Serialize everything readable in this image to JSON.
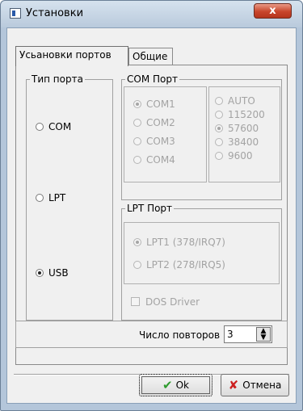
{
  "window": {
    "title": "Установки",
    "close_label": "x"
  },
  "tabs": [
    {
      "label": "Усьановки портов",
      "active": true
    },
    {
      "label": "Общие",
      "active": false
    }
  ],
  "port_type": {
    "title": "Тип порта",
    "options": [
      {
        "label": "COM",
        "checked": false
      },
      {
        "label": "LPT",
        "checked": false
      },
      {
        "label": "USB",
        "checked": true
      }
    ]
  },
  "com_port": {
    "title": "COM Порт",
    "ports": [
      {
        "label": "COM1",
        "checked": true
      },
      {
        "label": "COM2",
        "checked": false
      },
      {
        "label": "COM3",
        "checked": false
      },
      {
        "label": "COM4",
        "checked": false
      }
    ],
    "speeds": [
      {
        "label": "AUTO",
        "checked": false
      },
      {
        "label": "115200",
        "checked": false
      },
      {
        "label": "57600",
        "checked": true
      },
      {
        "label": "38400",
        "checked": false
      },
      {
        "label": "9600",
        "checked": false
      }
    ]
  },
  "lpt_port": {
    "title": "LPT Порт",
    "ports": [
      {
        "label": "LPT1 (378/IRQ7)",
        "checked": true
      },
      {
        "label": "LPT2 (278/IRQ5)",
        "checked": false
      }
    ],
    "dos_driver_label": "DOS Driver"
  },
  "repeats": {
    "label": "Число повторов",
    "value": "3"
  },
  "buttons": {
    "ok_label": "Ok",
    "cancel_label": "Отмена"
  },
  "colors": {
    "title_bar": "#b9cadc",
    "close_button": "#c8452b",
    "ok_icon": "#2e9b2e",
    "cancel_icon": "#cc1f1f"
  }
}
